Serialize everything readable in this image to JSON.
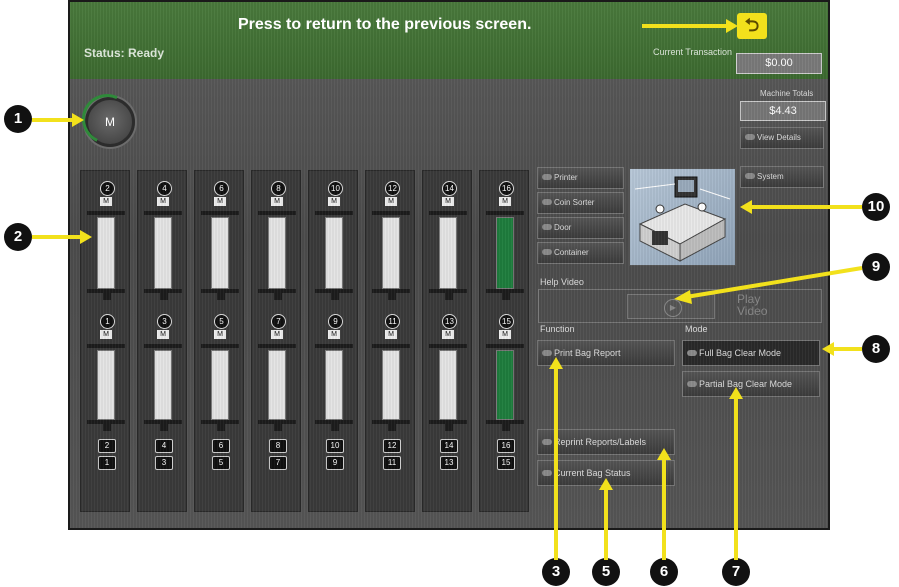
{
  "window": {
    "status": "Status: Ready",
    "current_transaction_label": "Current Transaction",
    "current_transaction_value": "$0.00",
    "machine_totals_label": "Machine Totals",
    "machine_totals_value": "$4.43",
    "manage_button": "M"
  },
  "callouts": {
    "back_instruction": "Press to return to the previous screen.",
    "badges": [
      "1",
      "2",
      "3",
      "5",
      "6",
      "7",
      "8",
      "9",
      "10"
    ]
  },
  "bins": {
    "top_numbers": [
      "2",
      "4",
      "6",
      "8",
      "10",
      "12",
      "14",
      "16"
    ],
    "bottom_numbers": [
      "1",
      "3",
      "5",
      "7",
      "9",
      "11",
      "13",
      "15"
    ],
    "tube_label": "M",
    "green_bin": "16"
  },
  "status_buttons": {
    "printer": "Printer",
    "coin_sorter": "Coin Sorter",
    "door": "Door",
    "container": "Container",
    "view_details": "View Details",
    "system": "System"
  },
  "help_video": {
    "label": "Help Video",
    "play": "Play",
    "play2": "Video"
  },
  "function": {
    "label": "Function",
    "print_bag_report": "Print Bag Report",
    "reprint": "Reprint Reports/Labels",
    "current_bag_status": "Current Bag Status"
  },
  "mode": {
    "label": "Mode",
    "full": "Full Bag Clear Mode",
    "partial": "Partial Bag Clear Mode"
  },
  "colors": {
    "header_green": "#3c6a30",
    "callout_yellow": "#f2e11c",
    "bin_green": "#1e7d3d"
  }
}
